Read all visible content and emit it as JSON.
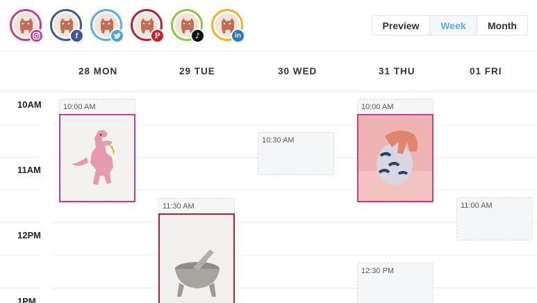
{
  "accounts": [
    {
      "network": "instagram",
      "ring_color": "#c23f8e",
      "badge_color": "#c63d93",
      "badge_glyph": "instagram-icon"
    },
    {
      "network": "facebook",
      "ring_color": "#3b5998",
      "badge_color": "#3b5998",
      "badge_glyph": "facebook-icon",
      "badge_text": "f"
    },
    {
      "network": "twitter",
      "ring_color": "#55acee",
      "badge_color": "#4aa3e6",
      "badge_glyph": "twitter-icon"
    },
    {
      "network": "pinterest",
      "ring_color": "#b71c3b",
      "badge_color": "#c8202d",
      "badge_glyph": "pinterest-icon",
      "badge_text": "P"
    },
    {
      "network": "tiktok",
      "ring_color": "#8cc63f",
      "badge_color": "#111111",
      "badge_glyph": "tiktok-icon",
      "badge_text": "♪"
    },
    {
      "network": "linkedin",
      "ring_color": "#f0b323",
      "badge_color": "#2f78b5",
      "badge_glyph": "linkedin-icon",
      "badge_text": "in"
    }
  ],
  "view_toggle": {
    "preview": "Preview",
    "week": "Week",
    "month": "Month",
    "selected": "Week",
    "selected_color": "#4fb6df"
  },
  "days": [
    "28 MON",
    "29 TUE",
    "30 WED",
    "31 THU",
    "01 FRI"
  ],
  "times": [
    "10AM",
    "11AM",
    "12PM",
    "1PM"
  ],
  "events": {
    "mon_1000": {
      "time": "10:00 AM",
      "image": "pink-dinosaur-figurine",
      "accent": "#c23f8e"
    },
    "tue_1130": {
      "time": "11:30 AM",
      "image": "stone-mortar",
      "accent": "#b71c3b"
    },
    "wed_1030": {
      "time": "10:30 AM"
    },
    "thu_1000": {
      "time": "10:00 AM",
      "image": "hand-on-patterned-vase",
      "accent": "#c23f8e"
    },
    "thu_1230": {
      "time": "12:30 PM"
    },
    "fri_1100": {
      "time": "11:00 AM"
    }
  }
}
